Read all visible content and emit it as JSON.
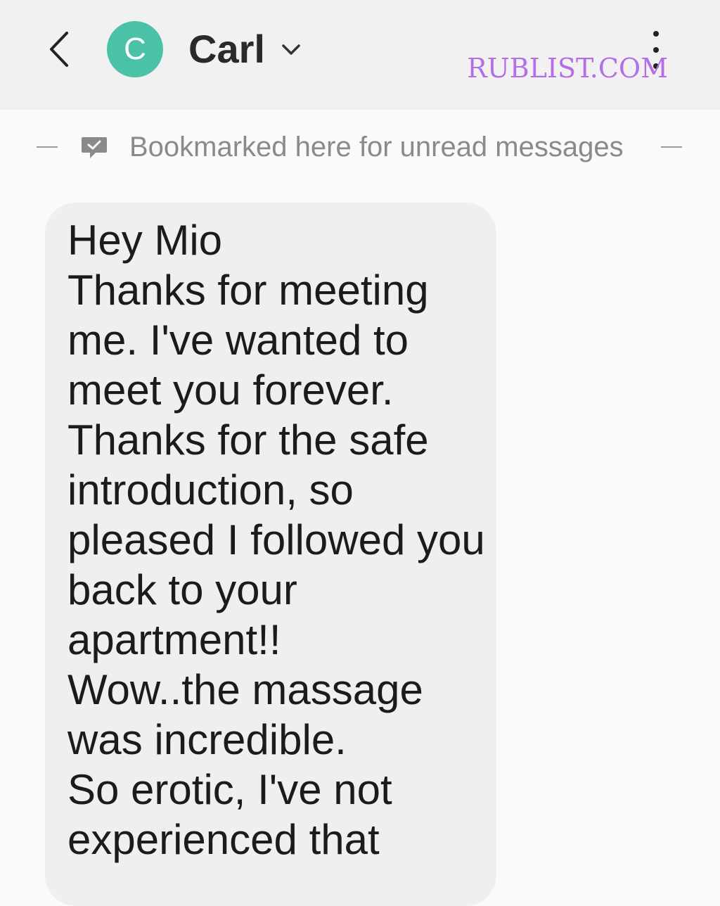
{
  "header": {
    "avatar_letter": "C",
    "contact_name": "Carl",
    "colors": {
      "background": "#f1f1f1",
      "avatar": "#49c2a8"
    },
    "icons": [
      "back-arrow-icon",
      "chevron-down-icon",
      "more-vert-icon"
    ]
  },
  "watermark": {
    "text": "RUBLIST.COM",
    "color": "#b36ee8"
  },
  "bookmark": {
    "text": "Bookmarked here for unread messages",
    "icon": "bookmark-check-icon"
  },
  "message": {
    "text": "Hey Mio\nThanks for meeting me. I've wanted to meet you forever.\nThanks for the safe introduction, so pleased I followed you back to your apartment!!\nWow..the massage was incredible.\nSo erotic, I've not experienced that",
    "bubble_color": "#efefef"
  }
}
